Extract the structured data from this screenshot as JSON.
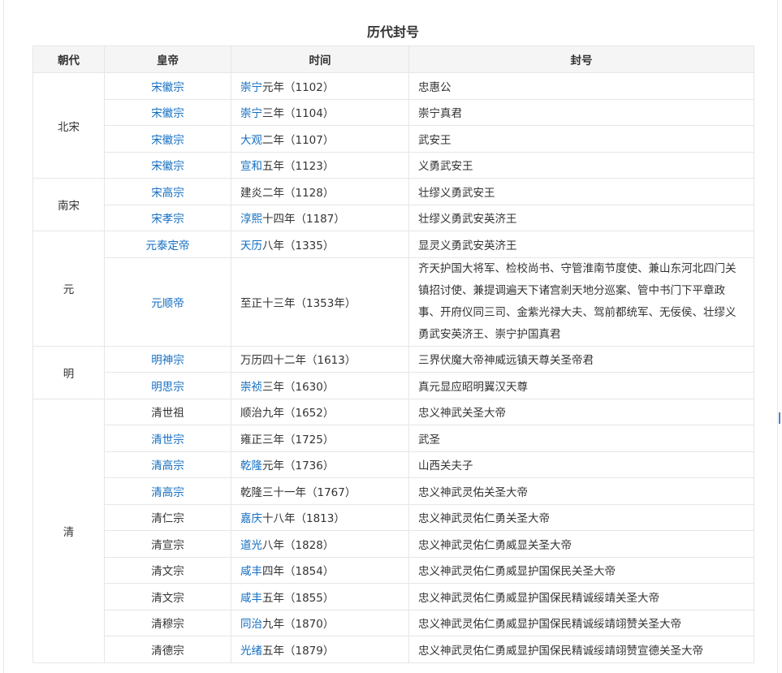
{
  "caption": "历代封号",
  "columns": [
    "朝代",
    "皇帝",
    "时间",
    "封号"
  ],
  "groups": [
    {
      "dynasty": "北宋",
      "rows": [
        {
          "emperor": "宋徽宗",
          "emperor_link": true,
          "era": "崇宁",
          "era_link": true,
          "era_rest": "元年（1102）",
          "title": "忠惠公"
        },
        {
          "emperor": "宋徽宗",
          "emperor_link": true,
          "era": "崇宁",
          "era_link": true,
          "era_rest": "三年（1104）",
          "title": "崇宁真君"
        },
        {
          "emperor": "宋徽宗",
          "emperor_link": true,
          "era": "大观",
          "era_link": true,
          "era_rest": "二年（1107）",
          "title": "武安王"
        },
        {
          "emperor": "宋徽宗",
          "emperor_link": true,
          "era": "宣和",
          "era_link": true,
          "era_rest": "五年（1123）",
          "title": "义勇武安王"
        }
      ]
    },
    {
      "dynasty": "南宋",
      "rows": [
        {
          "emperor": "宋高宗",
          "emperor_link": true,
          "era": "建炎",
          "era_link": false,
          "era_rest": "二年（1128）",
          "title": "壮缪义勇武安王"
        },
        {
          "emperor": "宋孝宗",
          "emperor_link": true,
          "era": "淳熙",
          "era_link": true,
          "era_rest": "十四年（1187）",
          "title": "壮缪义勇武安英济王"
        }
      ]
    },
    {
      "dynasty": "元",
      "rows": [
        {
          "emperor": "元泰定帝",
          "emperor_link": true,
          "era": "天历",
          "era_link": true,
          "era_rest": "八年（1335）",
          "title": "显灵义勇武安英济王"
        },
        {
          "emperor": "元顺帝",
          "emperor_link": true,
          "era": "至正",
          "era_link": false,
          "era_rest": "十三年（1353年）",
          "title": "齐天护国大将军、检校尚书、守管淮南节度使、兼山东河北四门关镇招讨使、兼提调遍天下诸宫剎天地分巡案、管中书门下平章政事、开府仪同三司、金紫光禄大夫、驾前都统军、无佞侯、壮缪义勇武安英济王、崇宁护国真君"
        }
      ]
    },
    {
      "dynasty": "明",
      "rows": [
        {
          "emperor": "明神宗",
          "emperor_link": true,
          "era": "万历",
          "era_link": false,
          "era_rest": "四十二年（1613）",
          "title": "三界伏魔大帝神威远镇天尊关圣帝君"
        },
        {
          "emperor": "明思宗",
          "emperor_link": true,
          "era": "崇祯",
          "era_link": true,
          "era_rest": "三年（1630）",
          "title": "真元显应昭明翼汉天尊"
        }
      ]
    },
    {
      "dynasty": "清",
      "rows": [
        {
          "emperor": "清世祖",
          "emperor_link": false,
          "era": "顺治",
          "era_link": false,
          "era_rest": "九年（1652）",
          "title": "忠义神武关圣大帝"
        },
        {
          "emperor": "清世宗",
          "emperor_link": true,
          "era": "雍正",
          "era_link": false,
          "era_rest": "三年（1725）",
          "title": "武圣"
        },
        {
          "emperor": "清高宗",
          "emperor_link": true,
          "era": "乾隆",
          "era_link": true,
          "era_rest": "元年（1736）",
          "title": "山西关夫子"
        },
        {
          "emperor": "清高宗",
          "emperor_link": true,
          "era": "乾隆",
          "era_link": false,
          "era_rest": "三十一年（1767）",
          "title": "忠义神武灵佑关圣大帝"
        },
        {
          "emperor": "清仁宗",
          "emperor_link": false,
          "era": "嘉庆",
          "era_link": true,
          "era_rest": "十八年（1813）",
          "title": "忠义神武灵佑仁勇关圣大帝"
        },
        {
          "emperor": "清宣宗",
          "emperor_link": false,
          "era": "道光",
          "era_link": true,
          "era_rest": "八年（1828）",
          "title": "忠义神武灵佑仁勇威显关圣大帝"
        },
        {
          "emperor": "清文宗",
          "emperor_link": false,
          "era": "咸丰",
          "era_link": true,
          "era_rest": "四年（1854）",
          "title": "忠义神武灵佑仁勇威显护国保民关圣大帝"
        },
        {
          "emperor": "清文宗",
          "emperor_link": false,
          "era": "咸丰",
          "era_link": true,
          "era_rest": "五年（1855）",
          "title": "忠义神武灵佑仁勇威显护国保民精诚绥靖关圣大帝"
        },
        {
          "emperor": "清穆宗",
          "emperor_link": false,
          "era": "同治",
          "era_link": true,
          "era_rest": "九年（1870）",
          "title": "忠义神武灵佑仁勇威显护国保民精诚绥靖翊赞关圣大帝"
        },
        {
          "emperor": "清德宗",
          "emperor_link": false,
          "era": "光绪",
          "era_link": true,
          "era_rest": "五年（1879）",
          "title": "忠义神武灵佑仁勇威显护国保民精诚绥靖翊赞宣德关圣大帝"
        }
      ]
    }
  ],
  "colors": {
    "link": "#136ec2",
    "header_bg": "#f5f5f5",
    "border": "#e6e6e6",
    "text": "#333333"
  }
}
